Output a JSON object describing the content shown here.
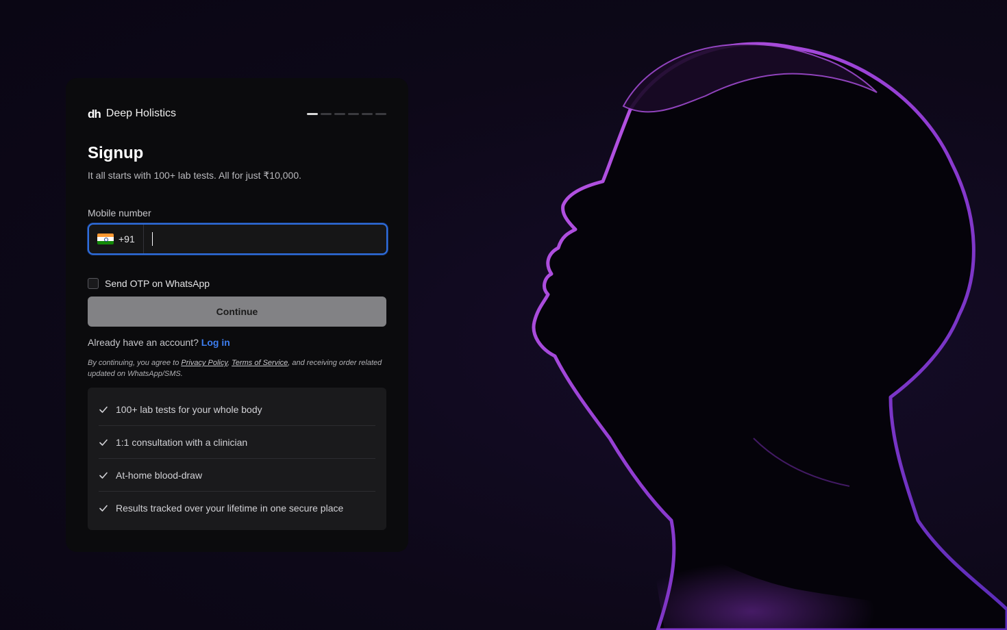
{
  "brand": {
    "logo_text": "dh",
    "name": "Deep Holistics"
  },
  "progress": {
    "total_steps": 6,
    "current_step": 1
  },
  "form": {
    "title": "Signup",
    "subtitle": "It all starts with 100+ lab tests. All for just ₹10,000.",
    "mobile_label": "Mobile number",
    "country_code": "+91",
    "country_flag": "india-flag-icon",
    "mobile_value": "",
    "whatsapp_label": "Send OTP on WhatsApp",
    "whatsapp_checked": false,
    "continue_label": "Continue",
    "login_prompt": "Already have an account?",
    "login_link": "Log in",
    "legal_prefix": "By continuing, you agree to",
    "privacy_link": "Privacy Policy",
    "legal_sep": ",",
    "terms_link": "Terms of Service",
    "legal_suffix": ", and receiving order related updated on WhatsApp/SMS."
  },
  "features": [
    {
      "text": "100+ lab tests for your whole body",
      "icon": "check-icon"
    },
    {
      "text": "1:1 consultation with a clinician",
      "icon": "check-icon"
    },
    {
      "text": "At-home blood-draw",
      "icon": "check-icon"
    },
    {
      "text": "Results tracked over your lifetime in one secure place",
      "icon": "check-icon"
    }
  ],
  "colors": {
    "background": "#0d0818",
    "card": "#0b0b0d",
    "accent": "#2f6fe0",
    "link": "#3d7ef0",
    "hero_glow": "#b04ad8"
  },
  "hero": {
    "subject": "profile-silhouette-image"
  }
}
